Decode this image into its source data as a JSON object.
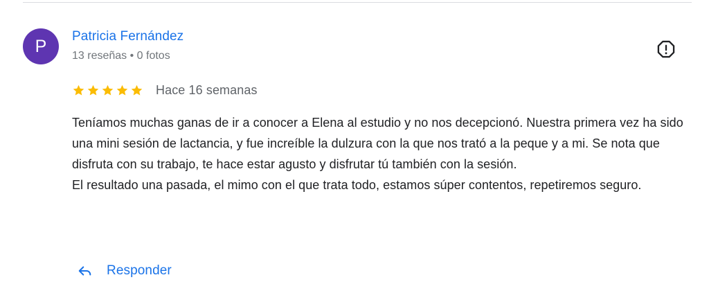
{
  "review": {
    "author": {
      "initial": "P",
      "name": "Patricia Fernández",
      "meta": "13 reseñas • 0 fotos",
      "avatar_color": "#5e35b1"
    },
    "rating": {
      "stars": 5,
      "max": 5,
      "star_color": "#fbbc04"
    },
    "date": "Hace 16 semanas",
    "text": [
      "Teníamos muchas ganas de ir a conocer a Elena al estudio y no nos decepcionó. Nuestra primera vez ha sido una mini sesión de lactancia, y fue increíble la dulzura con la que nos trató a la peque y a mi. Se nota que disfruta con su trabajo, te hace estar agusto y disfrutar tú también con la sesión.",
      "El resultado una pasada, el mimo con el que trata todo, estamos súper contentos, repetiremos seguro."
    ],
    "actions": {
      "reply_label": "Responder",
      "reply_icon": "reply-icon",
      "flag_icon": "report-flag-icon"
    }
  },
  "colors": {
    "link": "#1a73e8",
    "muted": "#70757a",
    "text": "#202124"
  }
}
